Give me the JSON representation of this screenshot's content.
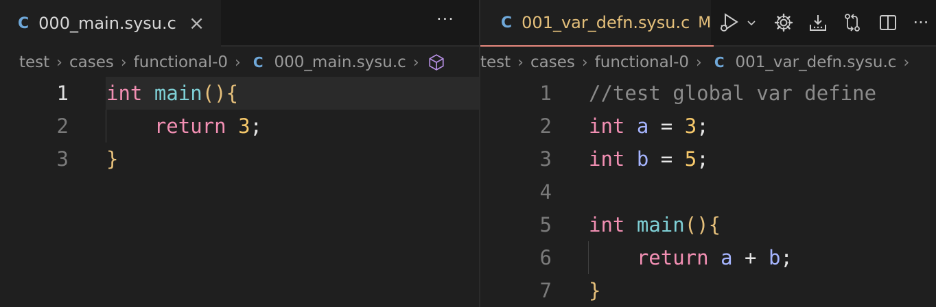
{
  "left": {
    "tab": {
      "label": "000_main.sysu.c",
      "icon": "C",
      "close": "×"
    },
    "more": "···",
    "breadcrumb": [
      "test",
      "cases",
      "functional-0",
      "000_main.sysu.c"
    ],
    "lines": [
      {
        "num": "1",
        "tokens": [
          [
            "int",
            "kw"
          ],
          [
            " ",
            "plain"
          ],
          [
            "main",
            "fn"
          ],
          [
            "()",
            "punc"
          ],
          [
            "{",
            "punc"
          ]
        ]
      },
      {
        "num": "2",
        "tokens": [
          [
            "    ",
            "plain"
          ],
          [
            "return",
            "kw"
          ],
          [
            " ",
            "plain"
          ],
          [
            "3",
            "num"
          ],
          [
            ";",
            "plain"
          ]
        ]
      },
      {
        "num": "3",
        "tokens": [
          [
            "}",
            "punc"
          ]
        ]
      }
    ]
  },
  "right": {
    "tab": {
      "label": "001_var_defn.sysu.c",
      "icon": "C",
      "modified": "M"
    },
    "breadcrumb": [
      "test",
      "cases",
      "functional-0",
      "001_var_defn.sysu.c"
    ],
    "toolbar_more": "···",
    "lines": [
      {
        "num": "1",
        "tokens": [
          [
            "//test global var define",
            "cmt"
          ]
        ]
      },
      {
        "num": "2",
        "tokens": [
          [
            "int",
            "kw"
          ],
          [
            " ",
            "plain"
          ],
          [
            "a",
            "var"
          ],
          [
            " = ",
            "plain"
          ],
          [
            "3",
            "num"
          ],
          [
            ";",
            "plain"
          ]
        ]
      },
      {
        "num": "3",
        "tokens": [
          [
            "int",
            "kw"
          ],
          [
            " ",
            "plain"
          ],
          [
            "b",
            "var"
          ],
          [
            " = ",
            "plain"
          ],
          [
            "5",
            "num"
          ],
          [
            ";",
            "plain"
          ]
        ]
      },
      {
        "num": "4",
        "tokens": []
      },
      {
        "num": "5",
        "tokens": [
          [
            "int",
            "kw"
          ],
          [
            " ",
            "plain"
          ],
          [
            "main",
            "fn"
          ],
          [
            "()",
            "punc"
          ],
          [
            "{",
            "punc"
          ]
        ]
      },
      {
        "num": "6",
        "tokens": [
          [
            "    ",
            "plain"
          ],
          [
            "return",
            "kw"
          ],
          [
            " ",
            "plain"
          ],
          [
            "a",
            "var"
          ],
          [
            " + ",
            "plain"
          ],
          [
            "b",
            "var"
          ],
          [
            ";",
            "plain"
          ]
        ]
      },
      {
        "num": "7",
        "tokens": [
          [
            "}",
            "punc"
          ]
        ]
      }
    ]
  },
  "colors": {
    "accent": "#e98a7f",
    "modified_tab": "#e5c07b",
    "c_icon": "#6fa8d9"
  },
  "icons": [
    "run-debug-icon",
    "chevron-down-icon",
    "gear-icon",
    "download-icon",
    "compare-changes-icon",
    "split-editor-icon",
    "more-actions-icon",
    "symbol-cube-icon"
  ]
}
